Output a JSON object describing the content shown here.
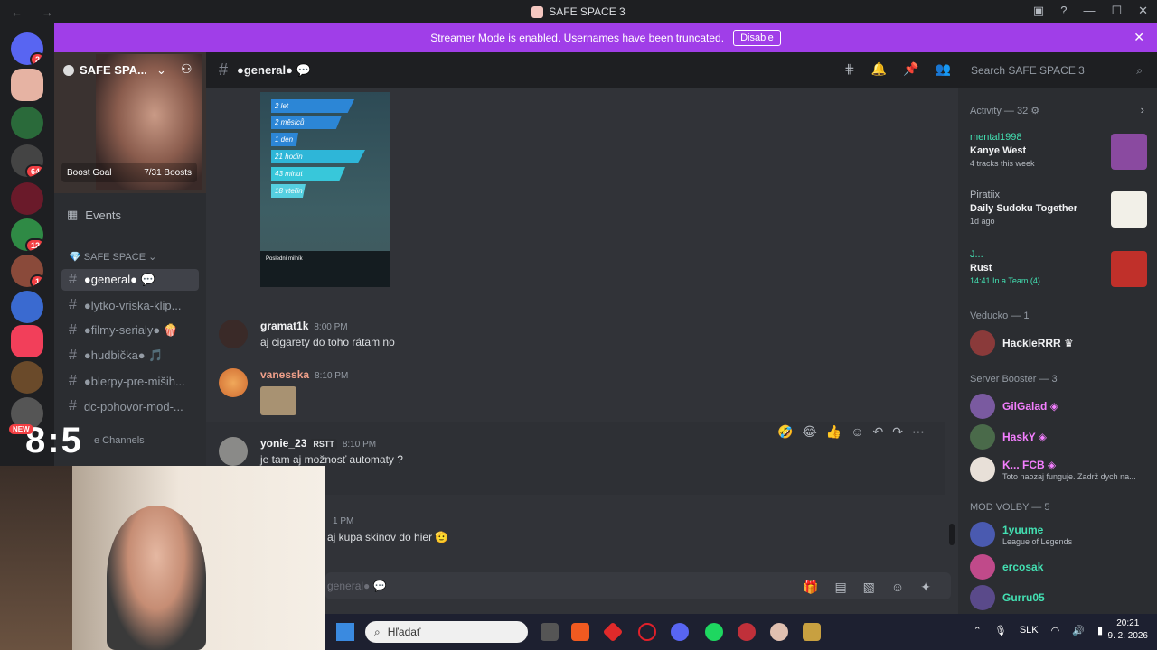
{
  "window": {
    "title": "SAFE SPACE 3",
    "back": "←",
    "forward": "→"
  },
  "banner": {
    "text": "Streamer Mode is enabled. Usernames have been truncated.",
    "button": "Disable"
  },
  "guild": {
    "name": "SAFE SPA...",
    "boost_label": "Boost Goal",
    "boost_count": "7/31 Boosts",
    "events": "Events"
  },
  "server_badges": [
    "2",
    "64",
    "12",
    "1"
  ],
  "category": "SAFE SPACE",
  "channels": [
    {
      "label": "●general● 💬"
    },
    {
      "label": "●lytko-vriska-klip..."
    },
    {
      "label": "●filmy-serialy● 🍿"
    },
    {
      "label": "●hudbička● 🎵"
    },
    {
      "label": "●blerpy-pre-miših..."
    },
    {
      "label": "dc-pohovor-mod-..."
    },
    {
      "label": "e Channels"
    }
  ],
  "channel_header": {
    "name": "●general● 💬"
  },
  "search": {
    "placeholder": "Search SAFE SPACE 3"
  },
  "image_card": {
    "bars": [
      "2 let",
      "2 měsíců",
      "1 den",
      "21 hodin",
      "43 minut",
      "18 vteřin"
    ],
    "footer": "Poslední milník"
  },
  "messages": [
    {
      "user": "gramat1k",
      "time": "8:00 PM",
      "text": "aj cigarety do toho rátam no"
    },
    {
      "user": "vanesska",
      "time": "8:10 PM",
      "text": ""
    },
    {
      "user": "yonie_23",
      "tag": "RSTT",
      "time": "8:10 PM",
      "text": "je tam aj možnosť automaty ?"
    },
    {
      "user": "",
      "time": "1 PM",
      "text": "aj kupa skinov do hier 🫡"
    }
  ],
  "composer": {
    "placeholder": "general● 💬"
  },
  "members": {
    "activity_header": "Activity — 32",
    "activities": [
      {
        "user": "mental1998",
        "title": "Kanye West",
        "sub": "4 tracks this week"
      },
      {
        "user": "Piratiix",
        "title": "Daily Sudoku Together",
        "sub": "1d ago"
      },
      {
        "user": "J...",
        "title": "Rust",
        "sub": "14:41  In a Team (4)"
      }
    ],
    "groups": [
      {
        "header": "Veducko — 1",
        "members": [
          {
            "name": "HackleRRR ♛",
            "sub": "",
            "color": "#f2f3f5"
          }
        ]
      },
      {
        "header": "Server Booster — 3",
        "members": [
          {
            "name": "GilGalad ◈",
            "sub": "",
            "color": "#f47fff"
          },
          {
            "name": "HaskY ◈",
            "sub": "",
            "color": "#f47fff"
          },
          {
            "name": "K... FCB ◈",
            "sub": "Toto naozaj funguje. Zadrž dych na...",
            "color": "#f47fff"
          }
        ]
      },
      {
        "header": "MOD VOLBY — 5",
        "members": [
          {
            "name": "1yuume",
            "sub": "League of Legends",
            "color": "#43e0b2"
          },
          {
            "name": "ercosak",
            "sub": "",
            "color": "#43e0b2"
          },
          {
            "name": "Gurru05",
            "sub": "",
            "color": "#43e0b2"
          }
        ]
      }
    ]
  },
  "taskbar": {
    "search": "Hľadať",
    "lang": "SLK",
    "time": "20:21",
    "date": "9. 2. 2026"
  },
  "overlay": {
    "timer": "8:5",
    "live": "NEW"
  },
  "colors": {
    "banner": "#a03ee8",
    "accent": "#5865f2"
  }
}
